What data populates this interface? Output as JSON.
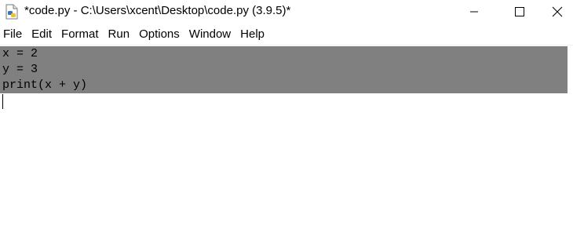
{
  "window": {
    "title": "*code.py - C:\\Users\\xcent\\Desktop\\code.py (3.9.5)*",
    "icon": "python-file-icon"
  },
  "menu": [
    {
      "label": "File"
    },
    {
      "label": "Edit"
    },
    {
      "label": "Format"
    },
    {
      "label": "Run"
    },
    {
      "label": "Options"
    },
    {
      "label": "Window"
    },
    {
      "label": "Help"
    }
  ],
  "editor": {
    "lines": [
      "x = 2",
      "y = 3",
      "print(x + y)"
    ],
    "selection_color": "#808080"
  }
}
